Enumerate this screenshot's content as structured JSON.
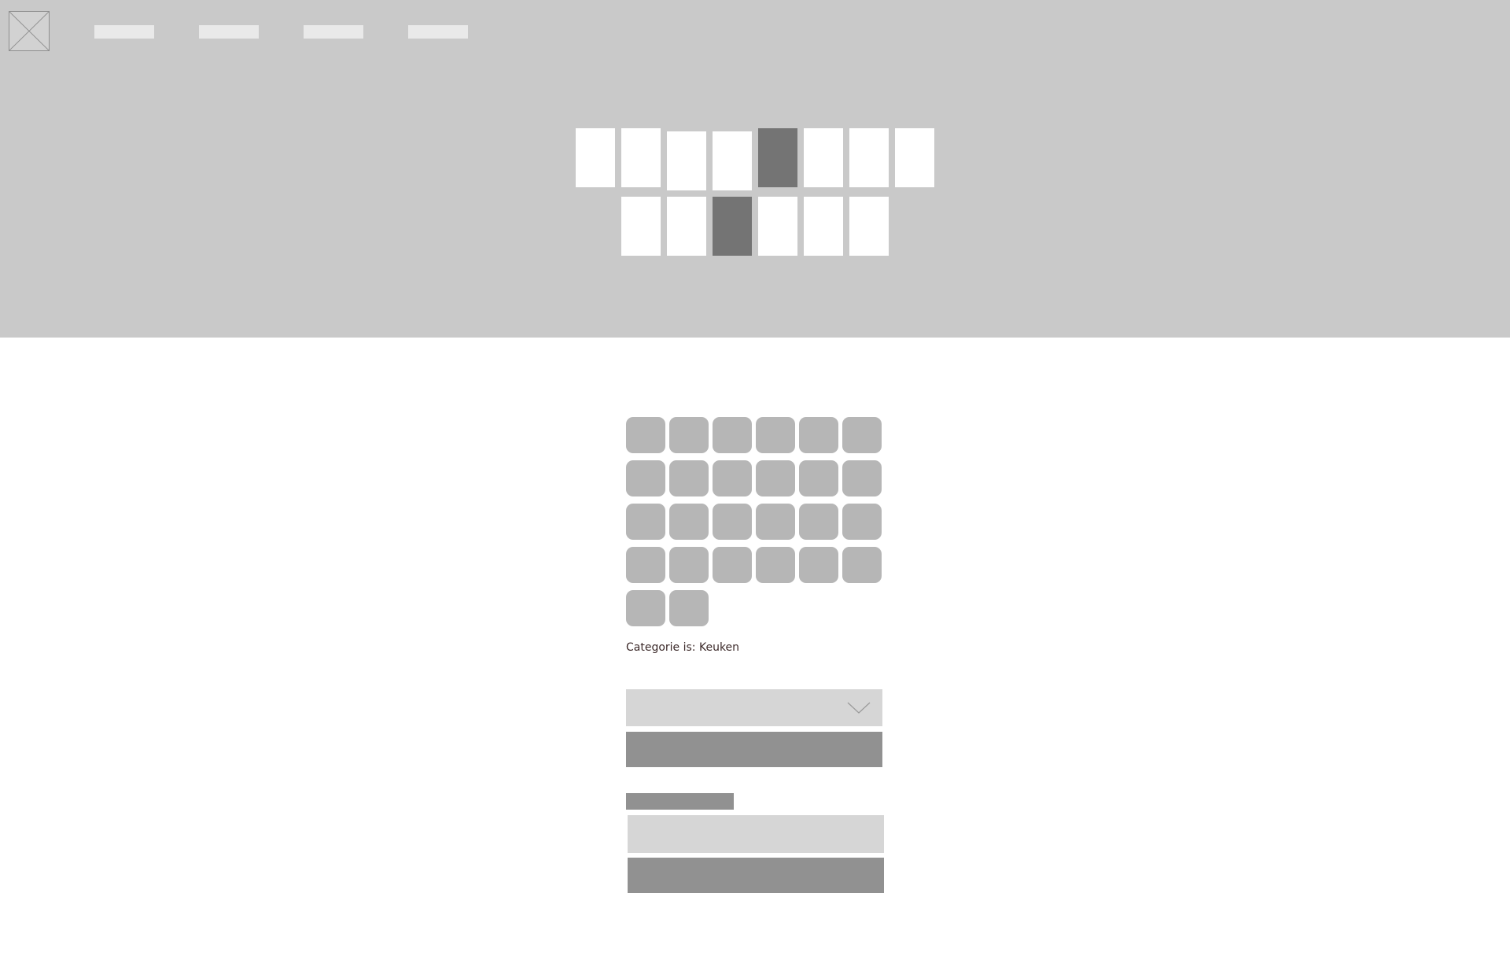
{
  "header": {
    "logo_icon": "image-placeholder-icon",
    "nav_items": [
      "",
      "",
      "",
      ""
    ]
  },
  "carousel": {
    "row1_count": 8,
    "row1_active_index": 4,
    "row2_count": 6,
    "row2_active_index": 2
  },
  "category_grid": {
    "rows": 5,
    "columns": 6,
    "count": 26
  },
  "category": {
    "text": "Categorie is: Keuken"
  },
  "filter": {
    "select_value": "",
    "chevron_icon": "chevron-down-icon",
    "button_label": ""
  },
  "form": {
    "label": "",
    "input_value": "",
    "button_label": ""
  },
  "colors": {
    "header_bg": "#c9c9c9",
    "active_tile": "#747474",
    "category_button": "#b6b6b6",
    "button": "#919191",
    "field": "#d6d6d6",
    "text": "#3c2a2a"
  }
}
